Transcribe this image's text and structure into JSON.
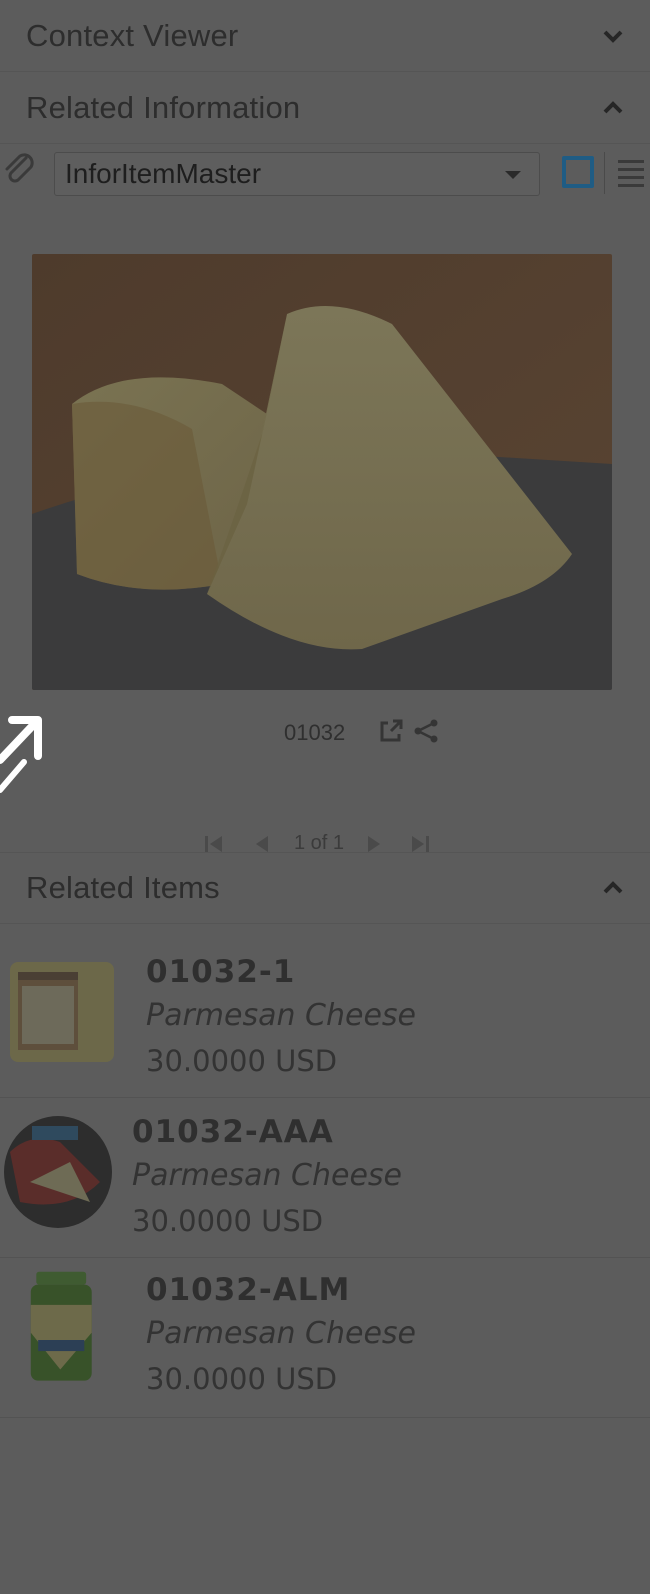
{
  "sections": {
    "context_viewer": {
      "title": "Context Viewer",
      "state": "collapsed"
    },
    "related_information": {
      "title": "Related Information",
      "state": "expanded"
    },
    "related_items": {
      "title": "Related Items",
      "state": "expanded"
    }
  },
  "toolbar": {
    "dropdown_value": "InforItemMaster",
    "attach_icon": "paperclip-icon",
    "tile_view_icon": "tile-view-icon",
    "list_view_icon": "list-view-icon"
  },
  "document": {
    "image_subject": "Parmesan cheese wedges",
    "caption": "01032",
    "open_icon": "external-link-icon",
    "share_icon": "share-icon"
  },
  "pager": {
    "label": "1 of 1"
  },
  "related_items": [
    {
      "code": "01032-1",
      "description": "Parmesan Cheese",
      "price": "30.0000 USD"
    },
    {
      "code": "01032-AAA",
      "description": "Parmesan Cheese",
      "price": "30.0000 USD"
    },
    {
      "code": "01032-ALM",
      "description": "Parmesan Cheese",
      "price": "30.0000 USD"
    }
  ],
  "colors": {
    "overlay_bg": "#5c5c5c",
    "accent": "#1f5c84"
  }
}
